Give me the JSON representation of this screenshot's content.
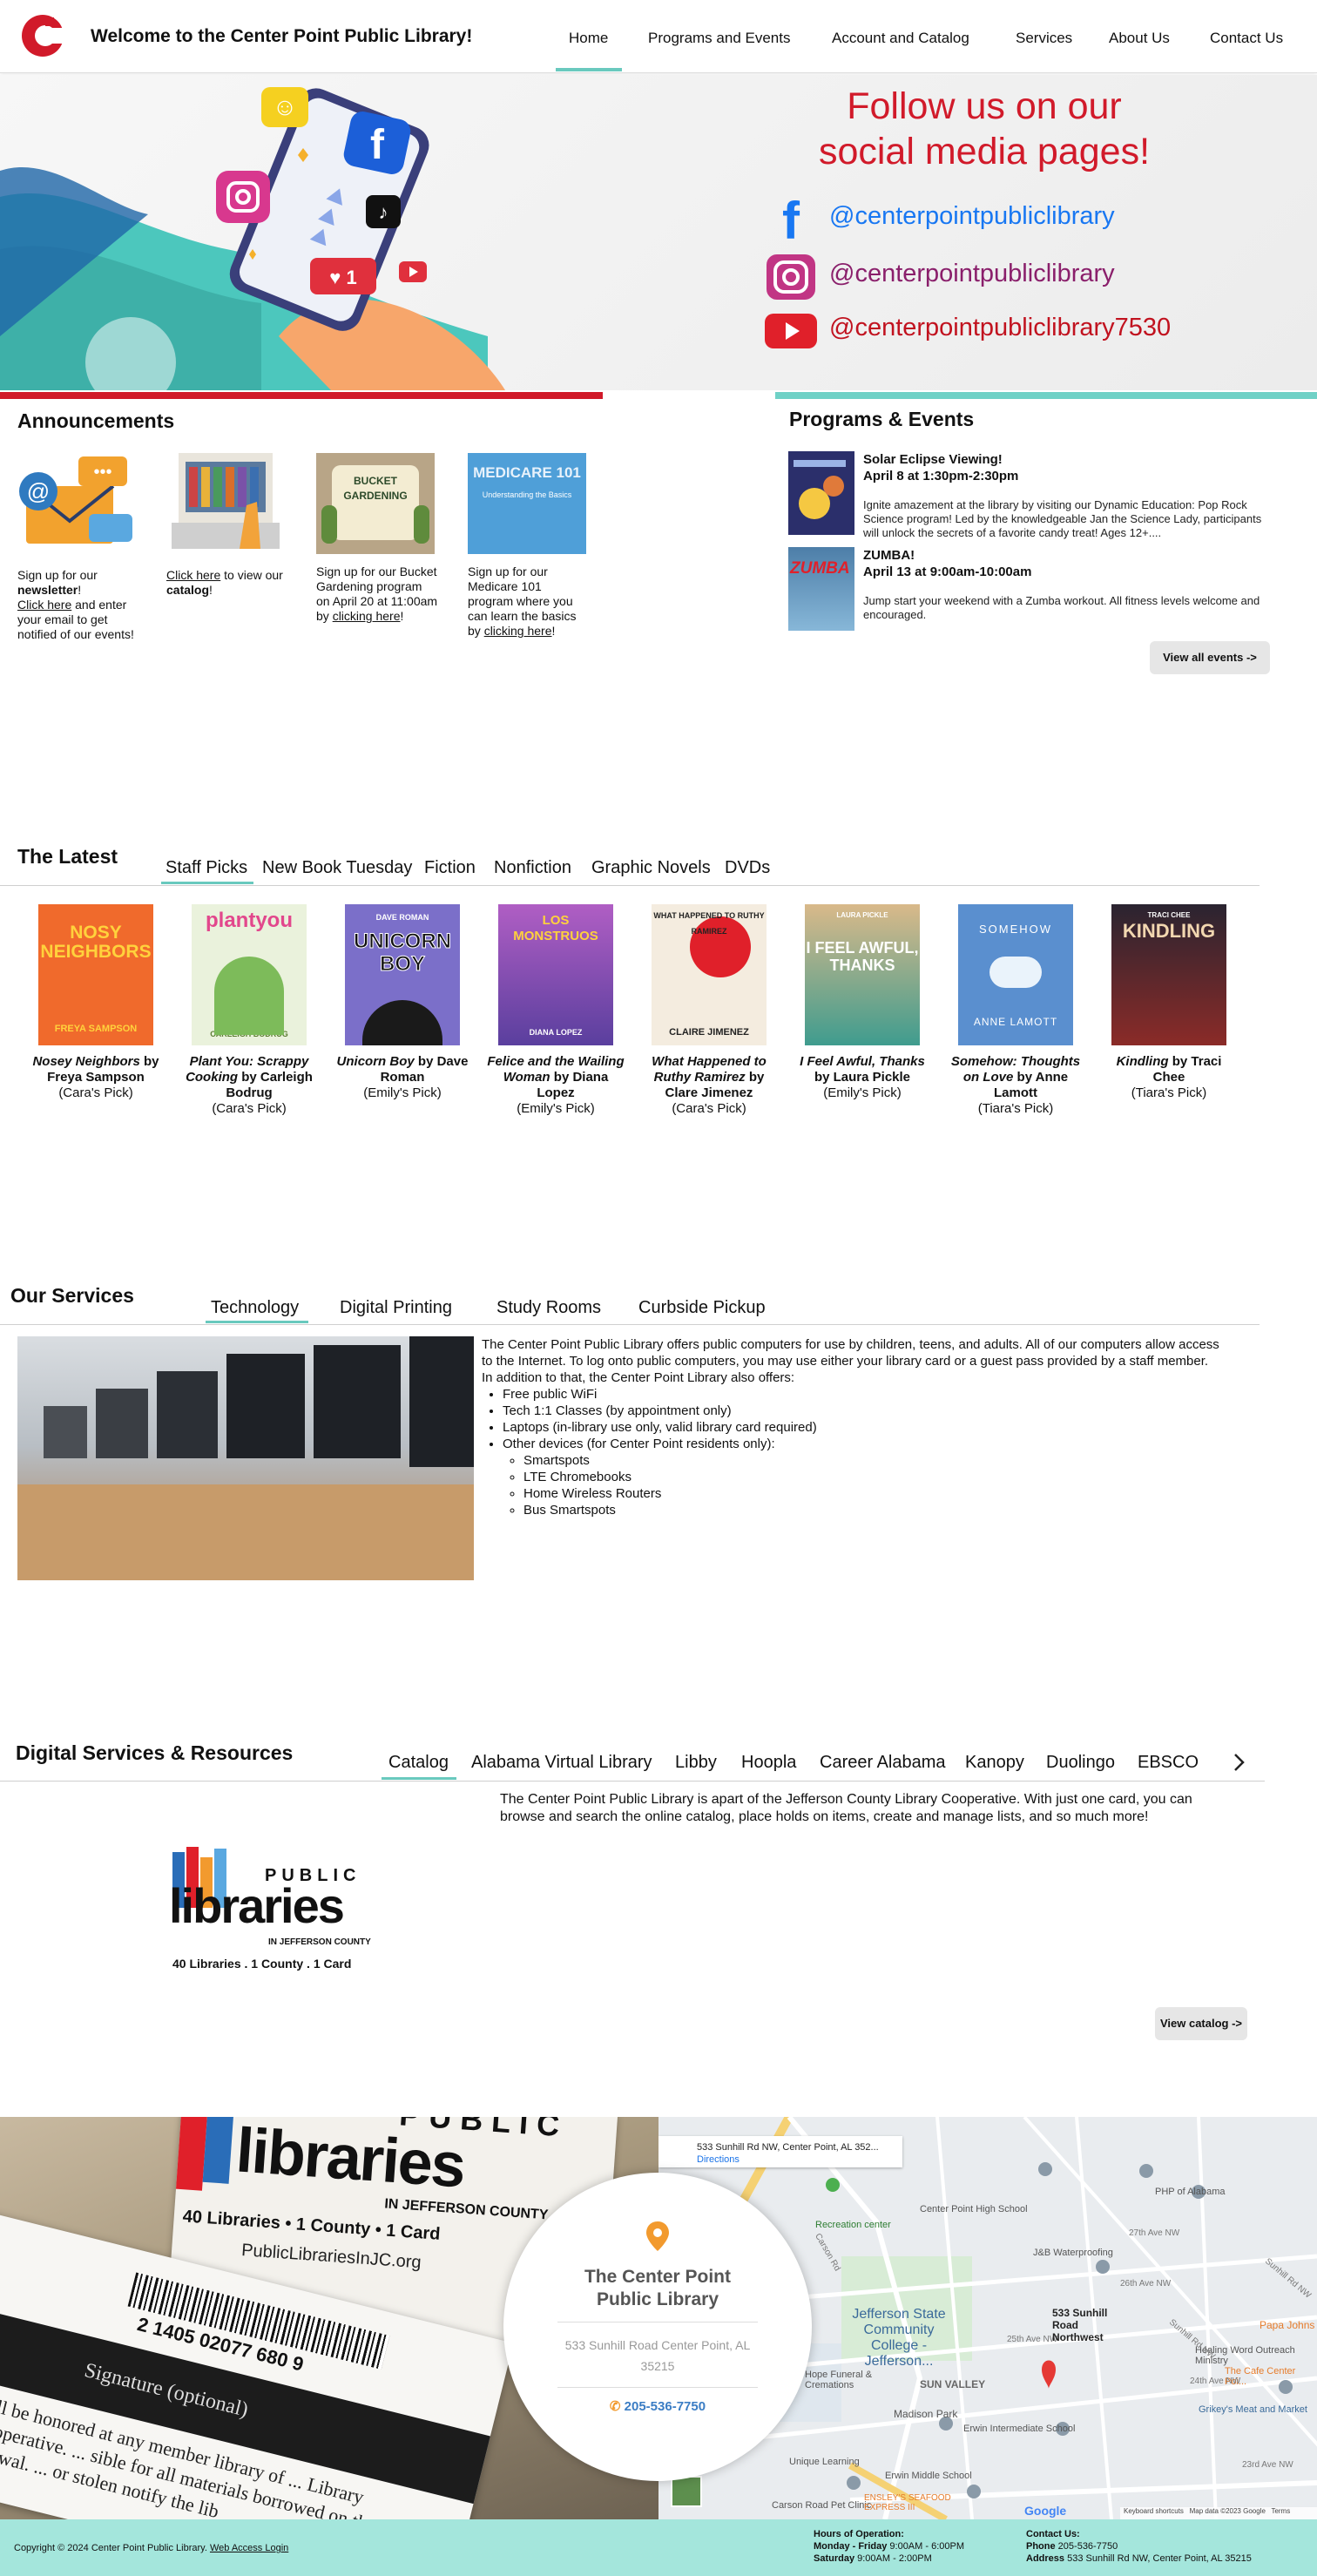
{
  "header": {
    "title": "Welcome to the Center Point Public Library!",
    "nav": [
      "Home",
      "Programs and Events",
      "Account and Catalog",
      "Services",
      "About Us",
      "Contact Us"
    ],
    "active_nav": "Home"
  },
  "hero": {
    "title_line1": "Follow us on our",
    "title_line2": "social media pages!",
    "socials": [
      {
        "icon": "facebook-icon",
        "handle": "@centerpointpubliclibrary"
      },
      {
        "icon": "instagram-icon",
        "handle": "@centerpointpubliclibrary"
      },
      {
        "icon": "youtube-icon",
        "handle": "@centerpointpubliclibrary7530"
      }
    ]
  },
  "announcements": {
    "heading": "Announcements",
    "cards": [
      {
        "lead": "Sign up for our ",
        "bold": "newsletter",
        "after": "!",
        "link": "Click here",
        "rest": " and enter your email to get notified of our events!"
      },
      {
        "link": "Click here",
        "mid": " to view our ",
        "bold": "catalog",
        "after": "!"
      },
      {
        "text": "Sign up for our Bucket Gardening program on April 20 at 11:00am by ",
        "link": "clicking here",
        "after": "!",
        "img_title": "BUCKET GARDENING"
      },
      {
        "text": "Sign up for our Medicare 101 program where you can learn the basics by ",
        "link": "clicking here",
        "after": "!",
        "img_title": "MEDICARE 101",
        "img_sub": "Understanding the Basics"
      }
    ]
  },
  "programs": {
    "heading": "Programs & Events",
    "events": [
      {
        "title": "Solar Eclipse Viewing!",
        "when": "April 8 at 1:30pm-2:30pm",
        "desc": "Ignite amazement at the library by visiting our Dynamic Education: Pop Rock Science program! Led by the knowledgeable Jan the Science Lady, participants will unlock the secrets of a favorite candy treat! Ages 12+...."
      },
      {
        "title": "ZUMBA!",
        "when": "April 13 at 9:00am-10:00am",
        "desc": "Jump start your weekend with a Zumba workout. All fitness levels welcome and encouraged.",
        "thumb_text": "ZUMBA"
      }
    ],
    "view_all": "View all events ->"
  },
  "latest": {
    "heading": "The Latest",
    "tabs": [
      "Staff Picks",
      "New Book Tuesday",
      "Fiction",
      "Nonfiction",
      "Graphic Novels",
      "DVDs"
    ],
    "books": [
      {
        "title": "Nosey Neighbors",
        "by": " by Freya Sampson",
        "pick": "(Cara's Pick)",
        "cover_text": "NOSY NEIGHBORS",
        "cover_author": "FREYA SAMPSON",
        "color": "#f06a2c"
      },
      {
        "title": "Plant You: Scrappy Cooking",
        "by": " by Carleigh Bodrug",
        "pick": "(Cara's Pick)",
        "cover_text": "plantyou",
        "cover_author": "CARLEIGH BODRUG",
        "color": "#7dbb5a"
      },
      {
        "title": "Unicorn Boy",
        "by": " by Dave Roman",
        "pick": "(Emily's Pick)",
        "cover_text": "UNICORN BOY",
        "cover_author": "DAVE ROMAN",
        "color": "#7b6fc9"
      },
      {
        "title": "Felice and the Wailing Woman",
        "by": " by Diana Lopez",
        "pick": "(Emily's Pick)",
        "cover_text": "LOS MONSTRUOS",
        "cover_author": "DIANA LOPEZ",
        "color": "#8c5ec4"
      },
      {
        "title": "What Happened to Ruthy Ramirez",
        "by": " by Clare Jimenez",
        "pick": "(Cara's Pick)",
        "cover_text": "WHAT HAPPENED TO RUTHY RAMIREZ",
        "cover_author": "CLAIRE JIMENEZ",
        "color": "#f1e6d6"
      },
      {
        "title": "I Feel Awful, Thanks",
        "by": " by Laura Pickle",
        "pick": "(Emily's Pick)",
        "cover_text": "I FEEL AWFUL, THANKS",
        "cover_author": "LAURA PICKLE",
        "color": "#3f9c8e"
      },
      {
        "title": "Somehow: Thoughts on Love",
        "by": " by Anne Lamott",
        "pick": "(Tiara's Pick)",
        "cover_text": "SOMEHOW",
        "cover_author": "ANNE LAMOTT",
        "color": "#5a8fcf"
      },
      {
        "title": "Kindling",
        "by": " by Traci Chee",
        "pick": "(Tiara's Pick)",
        "cover_text": "KINDLING",
        "cover_author": "TRACI CHEE",
        "color": "#5b2a2e"
      }
    ]
  },
  "services": {
    "heading": "Our Services",
    "tabs": [
      "Technology",
      "Digital Printing",
      "Study Rooms",
      "Curbside Pickup"
    ],
    "intro": "The Center Point Public Library offers public computers for use by children, teens, and adults. All of our computers allow access to the Internet. To log onto public computers, you may use either your library card or a guest pass provided by a staff member. In addition to that, the Center Point Library also offers:",
    "items": [
      "Free public WiFi",
      "Tech 1:1 Classes (by appointment only)",
      "Laptops (in-library use only, valid library card required)",
      "Other devices (for Center Point residents only):"
    ],
    "sub_items": [
      "Smartspots",
      "LTE Chromebooks",
      "Home Wireless Routers",
      "Bus Smartspots"
    ]
  },
  "digital": {
    "heading": "Digital Services & Resources",
    "tabs": [
      "Catalog",
      "Alabama Virtual Library",
      "Libby",
      "Hoopla",
      "Career Alabama",
      "Kanopy",
      "Duolingo",
      "EBSCO"
    ],
    "text": "The Center Point Public Library is apart of the Jefferson County Library Cooperative. With just one card, you can browse and search the online catalog, place holds on items, create and manage lists, and so much more!",
    "logo_public": "PUBLIC",
    "logo_libraries": "libraries",
    "logo_county": "IN JEFFERSON COUNTY",
    "logo_tagline": "40 Libraries . 1 County . 1 Card",
    "view_catalog": "View catalog ->"
  },
  "photo": {
    "card_public": "PUBLIC",
    "card_libraries": "libraries",
    "card_county": "IN JEFFERSON COUNTY",
    "card_tagline": "40 Libraries  •  1 County  •  1 Card",
    "card_url": "PublicLibrariesInJC.org",
    "card_number": "2 1405 02077 680 9",
    "signature": "Signature (optional)",
    "card_fineprint": "will be honored at any member library of ... Library Cooperative. ... sible for all materials borrowed on th... nnual renewal. ... or stolen notify the lib"
  },
  "map": {
    "search_text": "533 Sunhill Rd NW, Center Point, AL 352...",
    "directions": "Directions",
    "pin_label": "533 Sunhill Road Northwest",
    "places": [
      "Center Point High School",
      "PHP of Alabama",
      "J&B Waterproofing",
      "Jefferson State Community College - Jefferson...",
      "Healing Word Outreach Ministry",
      "Papa Johns",
      "The Cafe Center Poi...",
      "Grikey's Meat and Market",
      "Madison Park",
      "SUN VALLEY",
      "Erwin Intermediate School",
      "Unique Learning",
      "Erwin Middle School",
      "Carson Road Pet Clinic",
      "ENSLEY'S SEAFOOD EXPRESS III",
      "Recreation center",
      "Hope Funeral & Cremations"
    ],
    "streets": [
      "Carson Rd",
      "27th Ave NW",
      "26th Ave NW",
      "25th Ave NW",
      "24th Ave NW",
      "23rd Ave NW",
      "Sunhill Rd NW",
      "Sunhill Rd NW"
    ],
    "attribution": [
      "Keyboard shortcuts",
      "Map data ©2023 Google",
      "Terms"
    ],
    "google": "Google"
  },
  "contact_card": {
    "name": "The Center Point Public Library",
    "address": "533 Sunhill Road Center Point, AL 35215",
    "phone": "205-536-7750"
  },
  "footer": {
    "copyright": "Copyright © 2024 Center Point Public Library.",
    "login": "Web Access Login",
    "hours_label": "Hours of Operation:",
    "hours": [
      {
        "day": "Monday - Friday",
        "time": " 9:00AM - 6:00PM"
      },
      {
        "day": "Saturday",
        "time": " 9:00AM - 2:00PM"
      }
    ],
    "contact_label": "Contact Us:",
    "phone_label": "Phone",
    "phone": " 205-536-7750",
    "address_label": "Address",
    "address": " 533 Sunhill Rd NW, Center Point, AL 35215"
  },
  "colors": {
    "brand_red": "#d11a2a",
    "teal": "#69c9be",
    "footer": "#a4e6dc"
  }
}
